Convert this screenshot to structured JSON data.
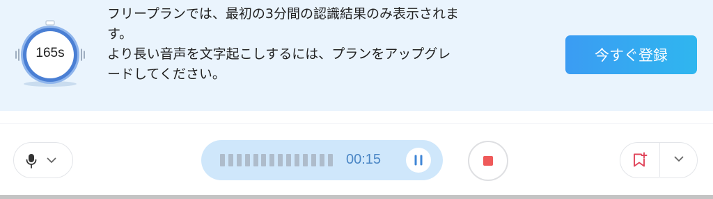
{
  "banner": {
    "timer_label": "165s",
    "message_lines": [
      "フリープランでは、最初の3分間の認識結果のみ表示されま",
      "す。",
      "より長い音声を文字起こしするには、プランをアップグレ",
      "ードしてください。"
    ],
    "register_button_label": "今すぐ登録"
  },
  "controls": {
    "mic_icon": "microphone-icon",
    "mic_dropdown_icon": "chevron-down-icon",
    "waveform_bars": 14,
    "elapsed_time": "00:15",
    "pause_icon": "pause-icon",
    "stop_icon": "stop-icon",
    "bookmark_icon": "bookmark-add-icon",
    "bookmark_dropdown_icon": "chevron-down-icon"
  },
  "colors": {
    "banner_bg": "#eaf4fd",
    "accent_blue": "#3b9cf3",
    "timer_ring": "#4a7fd4",
    "recording_pill": "#cfe7fb",
    "elapsed_text": "#4a86c5",
    "stop_red": "#ef5a5a",
    "bookmark_red": "#e0445a"
  }
}
